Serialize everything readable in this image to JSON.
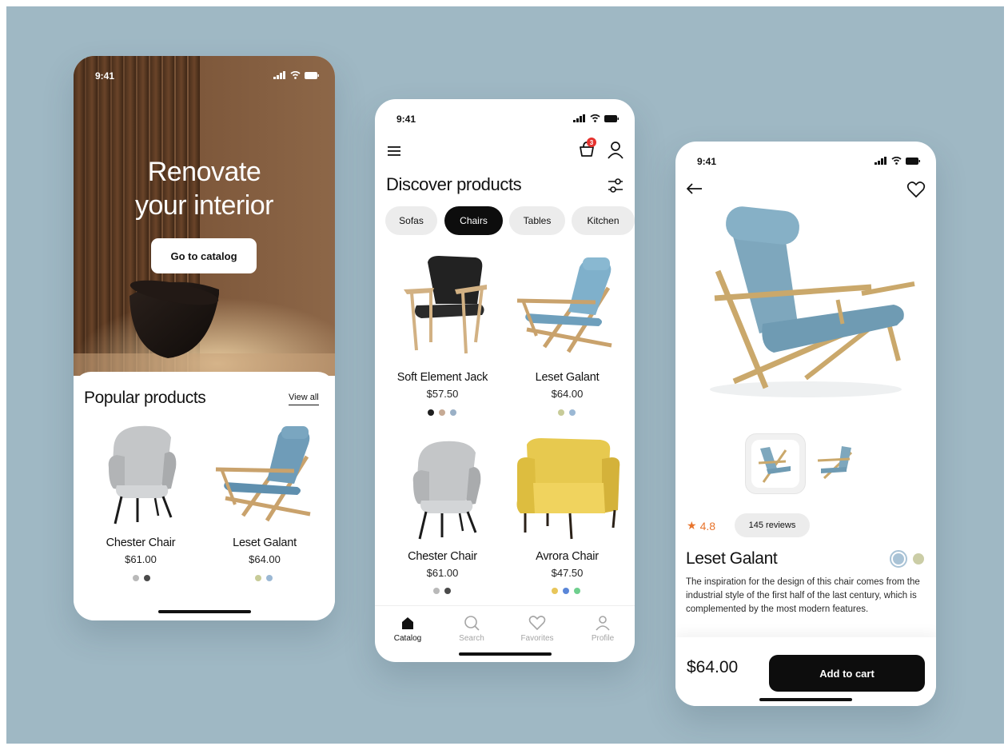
{
  "colors": {
    "background": "#9fb8c4",
    "hero_brown": "#7a5537",
    "accent_black": "#0d0d0d",
    "rating_orange": "#e8742c",
    "badge_red": "#e5322e"
  },
  "screen1": {
    "status_time": "9:41",
    "hero_title_line1": "Renovate",
    "hero_title_line2": "your interior",
    "cta_label": "Go to catalog",
    "section_title": "Popular products",
    "view_all_label": "View all",
    "products": [
      {
        "name": "Chester Chair",
        "price": "$61.00",
        "swatches": [
          "#b9b9b9",
          "#4a4a4a"
        ]
      },
      {
        "name": "Leset Galant",
        "price": "$64.00",
        "swatches": [
          "#c7cb98",
          "#9bb8d4"
        ]
      }
    ]
  },
  "screen2": {
    "status_time": "9:41",
    "cart_badge_count": "3",
    "title": "Discover products",
    "categories": [
      {
        "label": "Sofas",
        "active": false
      },
      {
        "label": "Chairs",
        "active": true
      },
      {
        "label": "Tables",
        "active": false
      },
      {
        "label": "Kitchen",
        "active": false
      }
    ],
    "products": [
      {
        "name": "Soft Element Jack",
        "price": "$57.50",
        "swatches": [
          "#1e1e1e",
          "#c6aa94",
          "#9ab0c6"
        ]
      },
      {
        "name": "Leset Galant",
        "price": "$64.00",
        "swatches": [
          "#c7cb98",
          "#9bb8d4"
        ]
      },
      {
        "name": "Chester Chair",
        "price": "$61.00",
        "swatches": [
          "#b9b9b9",
          "#4a4a4a"
        ]
      },
      {
        "name": "Avrora Chair",
        "price": "$47.50",
        "swatches": [
          "#e8c65a",
          "#5a86d8",
          "#6fcf8e"
        ]
      }
    ],
    "nav": [
      {
        "label": "Catalog",
        "icon": "home-icon",
        "active": true
      },
      {
        "label": "Search",
        "icon": "search-icon",
        "active": false
      },
      {
        "label": "Favorites",
        "icon": "heart-icon",
        "active": false
      },
      {
        "label": "Profile",
        "icon": "user-icon",
        "active": false
      }
    ]
  },
  "screen3": {
    "status_time": "9:41",
    "rating": "4.8",
    "reviews_label": "145 reviews",
    "product_name": "Leset Galant",
    "description": "The inspiration for the design of this chair comes from the industrial style of the first half of the last century, which is complemented by the most modern features.",
    "color_options": [
      "#a9c3d6",
      "#cbcda6"
    ],
    "price": "$64.00",
    "add_to_cart_label": "Add to cart"
  }
}
